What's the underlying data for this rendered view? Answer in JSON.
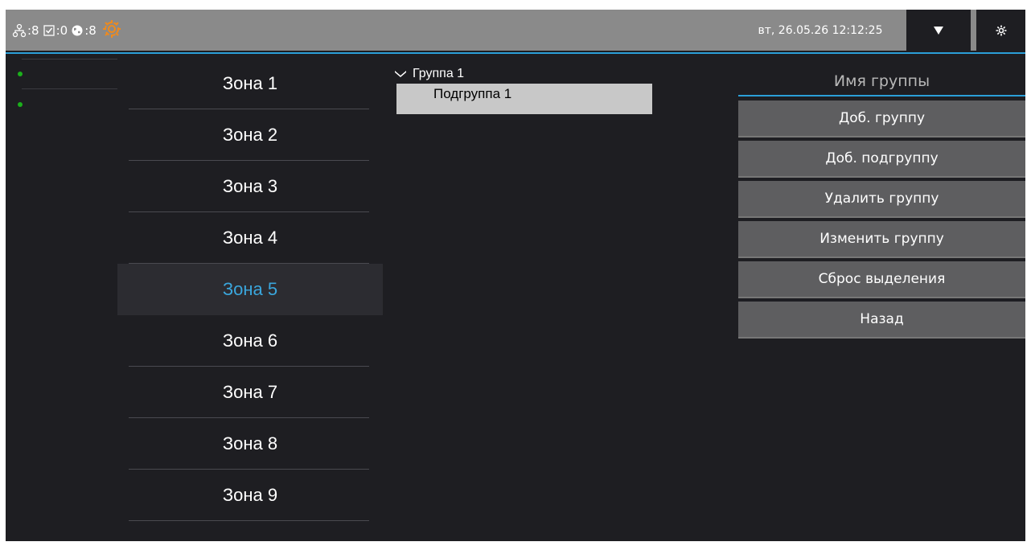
{
  "status": {
    "network_count": ":8",
    "checked_count": ":0",
    "globe_count": ":8",
    "warning_icon": "gear-warning-icon",
    "warning_color": "#f08a1c"
  },
  "header": {
    "datetime": "вт, 26.05.26 12:12:25"
  },
  "colors": {
    "accent": "#2b9fd8",
    "background": "#1e1e22",
    "topbar": "#8a8a8a",
    "active_zone_text": "#3aa6dc",
    "status_dot": "#1bb01b"
  },
  "zones": [
    "Зона 1",
    "Зона 2",
    "Зона 3",
    "Зона 4",
    "Зона 5",
    "Зона 6",
    "Зона 7",
    "Зона 8",
    "Зона 9"
  ],
  "selected_zone": "Зона 5",
  "tree": {
    "group": "Группа 1",
    "subgroup": "Подгруппа 1"
  },
  "actions": {
    "group_name_placeholder": "Имя группы",
    "add_group": "Доб. группу",
    "add_subgroup": "Доб. подгруппу",
    "delete_group": "Удалить группу",
    "edit_group": "Изменить группу",
    "reset_selection": "Сброс выделения",
    "back": "Назад"
  }
}
